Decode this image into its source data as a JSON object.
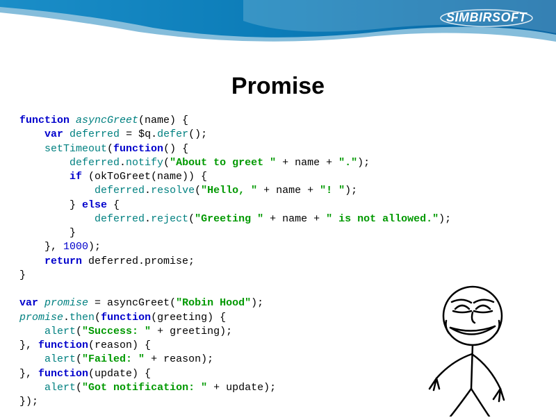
{
  "brand": "SIMBIRSOFT",
  "title": "Promise",
  "code": {
    "l1a": "function",
    "l1b": "asyncGreet",
    "l1c": "(name) {",
    "l2a": "var",
    "l2b": "deferred",
    "l2c": " = $q.",
    "l2d": "defer",
    "l2e": "();",
    "l3a": "setTimeout",
    "l3b": "(",
    "l3c": "function",
    "l3d": "() {",
    "l4a": "deferred",
    "l4b": ".",
    "l4c": "notify",
    "l4d": "(",
    "l4e": "\"About to greet \"",
    "l4f": " + name + ",
    "l4g": "\".\"",
    "l4h": ");",
    "l5a": "if",
    "l5b": " (okToGreet(name)) {",
    "l6a": "deferred",
    "l6b": ".",
    "l6c": "resolve",
    "l6d": "(",
    "l6e": "\"Hello, \"",
    "l6f": " + name + ",
    "l6g": "\"! \"",
    "l6h": ");",
    "l7a": "} ",
    "l7b": "else",
    "l7c": " {",
    "l8a": "deferred",
    "l8b": ".",
    "l8c": "reject",
    "l8d": "(",
    "l8e": "\"Greeting \"",
    "l8f": " + name + ",
    "l8g": "\" is not allowed.\"",
    "l8h": ");",
    "l9": "}",
    "l10a": "}, ",
    "l10b": "1000",
    "l10c": ");",
    "l11a": "return",
    "l11b": " deferred.promise;",
    "l12": "}",
    "l14a": "var",
    "l14b": "promise",
    "l14c": " = asyncGreet(",
    "l14d": "\"Robin Hood\"",
    "l14e": ");",
    "l15a": "promise",
    "l15b": ".",
    "l15c": "then",
    "l15d": "(",
    "l15e": "function",
    "l15f": "(greeting) {",
    "l16a": "alert",
    "l16b": "(",
    "l16c": "\"Success: \"",
    "l16d": " + greeting);",
    "l17a": "}, ",
    "l17b": "function",
    "l17c": "(reason) {",
    "l18a": "alert",
    "l18b": "(",
    "l18c": "\"Failed: \"",
    "l18d": " + reason);",
    "l19a": "}, ",
    "l19b": "function",
    "l19c": "(update) {",
    "l20a": "alert",
    "l20b": "(",
    "l20c": "\"Got notification: \"",
    "l20d": " + update);",
    "l21": "});"
  }
}
